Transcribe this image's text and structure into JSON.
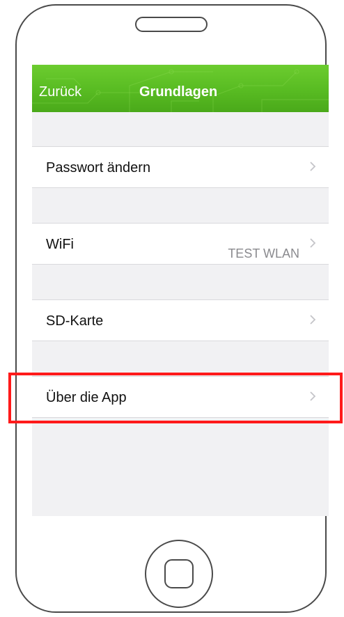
{
  "navbar": {
    "back_label": "Zurück",
    "title": "Grundlagen",
    "color": "#5cbf24"
  },
  "settings": {
    "items": [
      {
        "label": "Passwort ändern",
        "value": ""
      },
      {
        "label": "WiFi",
        "value": "TEST WLAN"
      },
      {
        "label": "SD-Karte",
        "value": ""
      },
      {
        "label": "Über die App",
        "value": ""
      }
    ]
  },
  "highlight": {
    "target": "Über die App",
    "color": "#ff1a1a"
  },
  "icons": {
    "chevron": "chevron-right-icon",
    "home": "home-button-icon"
  }
}
